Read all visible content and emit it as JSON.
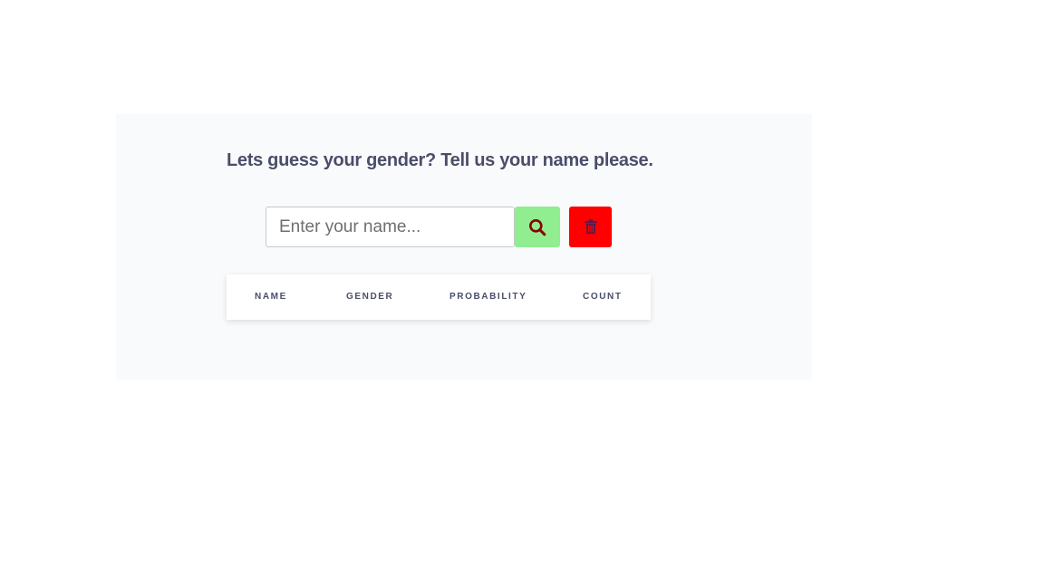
{
  "app": {
    "heading": "Lets guess your gender? Tell us your name please."
  },
  "search": {
    "placeholder": "Enter your name...",
    "value": "",
    "search_button_icon": "search-icon",
    "delete_button_icon": "trash-icon"
  },
  "colors": {
    "search_button_bg": "#90ee90",
    "search_icon": "#8b0000",
    "delete_button_bg": "#ff0000",
    "delete_icon": "#5a1a4a",
    "heading": "#4a4e69"
  },
  "table": {
    "columns": [
      "NAME",
      "GENDER",
      "PROBABILITY",
      "COUNT"
    ],
    "rows": []
  }
}
